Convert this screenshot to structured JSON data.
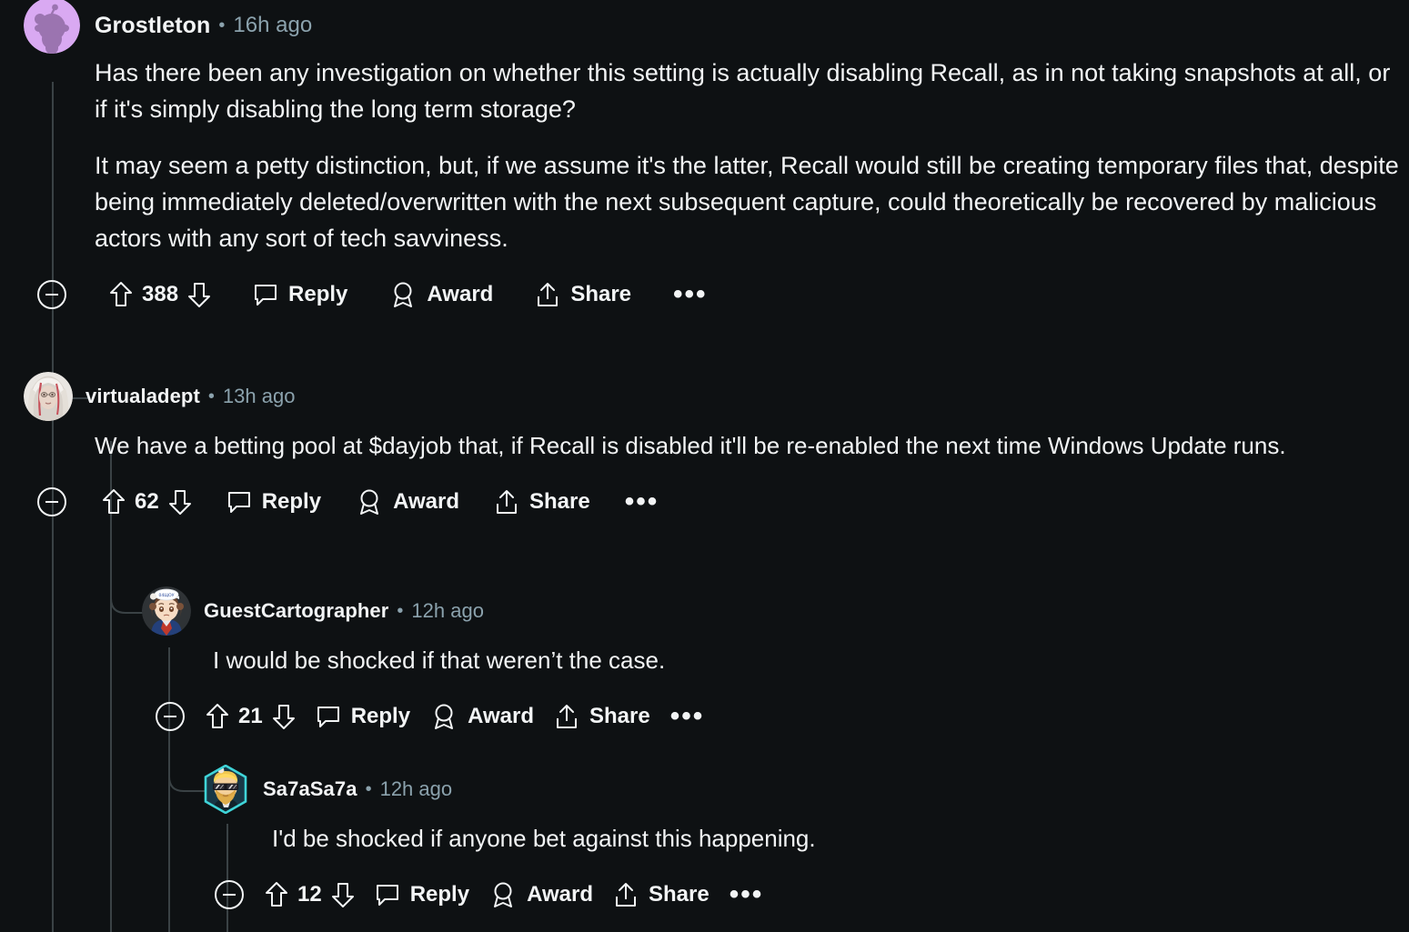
{
  "theme": {
    "background": "#0e1113",
    "text": "#f2f4f5",
    "muted": "#8ba2ad",
    "threadline": "#3a4245",
    "avatar_purple": "#d7a8f0"
  },
  "comments": [
    {
      "username": "Grostleton",
      "timestamp": "16h ago",
      "separator": "•",
      "avatar": "snoo-purple-avatar",
      "paragraphs": [
        "Has there been any investigation on whether this setting is actually disabling Recall, as in not taking snapshots at all, or if it's simply disabling the long term storage?",
        "It may seem a petty distinction, but, if we assume it's the latter, Recall would still be creating temporary files that, despite being immediately deleted/overwritten with the next subsequent capture, could theoretically be recovered by malicious actors with any sort of tech savviness."
      ],
      "actions": {
        "collapse": "collapse-icon",
        "upvote": "upvote-icon",
        "score": "388",
        "downvote": "downvote-icon",
        "reply_label": "Reply",
        "award_label": "Award",
        "share_label": "Share",
        "overflow": "•••"
      }
    },
    {
      "username": "virtualadept",
      "timestamp": "13h ago",
      "separator": "•",
      "avatar": "portrait-white-hair-avatar",
      "paragraphs": [
        "We have a betting pool at $dayjob that, if Recall is disabled it'll be re-enabled the next time Windows Update runs."
      ],
      "actions": {
        "collapse": "collapse-icon",
        "upvote": "upvote-icon",
        "score": "62",
        "downvote": "downvote-icon",
        "reply_label": "Reply",
        "award_label": "Award",
        "share_label": "Share",
        "overflow": "•••"
      }
    },
    {
      "username": "GuestCartographer",
      "timestamp": "12h ago",
      "separator": "•",
      "avatar": "anime-sailor-hat-avatar",
      "paragraphs": [
        "I would be shocked if that weren’t the case."
      ],
      "actions": {
        "collapse": "collapse-icon",
        "upvote": "upvote-icon",
        "score": "21",
        "downvote": "downvote-icon",
        "reply_label": "Reply",
        "award_label": "Award",
        "share_label": "Share",
        "overflow": "•••"
      }
    },
    {
      "username": "Sa7aSa7a",
      "timestamp": "12h ago",
      "separator": "•",
      "avatar": "hexagon-sunglasses-avatar",
      "paragraphs": [
        "I'd be shocked if anyone bet against this happening."
      ],
      "actions": {
        "collapse": "collapse-icon",
        "upvote": "upvote-icon",
        "score": "12",
        "downvote": "downvote-icon",
        "reply_label": "Reply",
        "award_label": "Award",
        "share_label": "Share",
        "overflow": "•••"
      }
    }
  ]
}
